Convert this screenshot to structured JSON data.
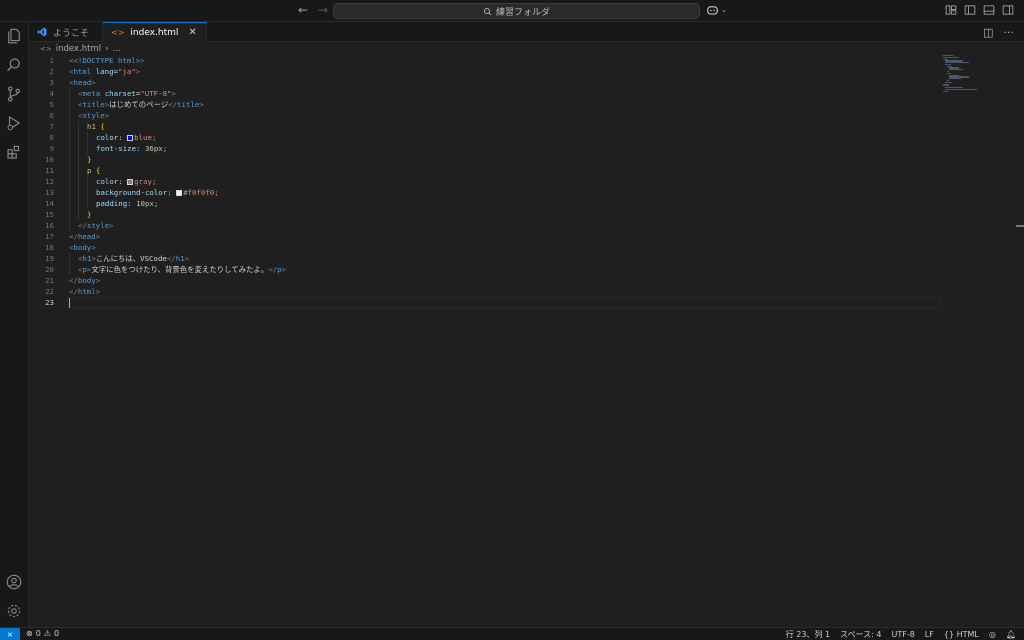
{
  "titlebar": {
    "search_text": "練習フォルダ"
  },
  "tabs": [
    {
      "label": "ようこそ"
    },
    {
      "label": "index.html"
    }
  ],
  "breadcrumb": {
    "file": "index.html",
    "more": "..."
  },
  "editor": {
    "lines": [
      "1",
      "2",
      "3",
      "4",
      "5",
      "6",
      "7",
      "8",
      "9",
      "10",
      "11",
      "12",
      "13",
      "14",
      "15",
      "16",
      "17",
      "18",
      "19",
      "20",
      "21",
      "22",
      "23"
    ],
    "code": {
      "l1": "<!DOCTYPE html>",
      "l2_tag": "html",
      "l2_attr": "lang",
      "l2_val": "\"ja\"",
      "l3": "head",
      "l4_tag": "meta",
      "l4_attr": "charset",
      "l4_val": "\"UTF-8\"",
      "l5_tag": "title",
      "l5_text": "はじめてのページ",
      "l6": "style",
      "l7_sel": "h1",
      "l8_prop": "color:",
      "l8_val": "blue;",
      "l9_prop": "font-size:",
      "l9_val": "36px;",
      "l11_sel": "p",
      "l12_prop": "color:",
      "l12_val": "gray;",
      "l13_prop": "background-color:",
      "l13_val": "#f0f0f0;",
      "l14_prop": "padding:",
      "l14_val": "10px;",
      "l16": "style",
      "l17": "head",
      "l18": "body",
      "l19_tag": "h1",
      "l19_text": "こんにちは、VSCode",
      "l20_tag": "p",
      "l20_text": "文字に色をつけたり、背景色を変えたりしてみたよ。",
      "l21": "body",
      "l22": "html"
    }
  },
  "statusbar": {
    "errors": "0",
    "warnings": "0",
    "position": "行 23、列 1",
    "spaces": "スペース: 4",
    "encoding": "UTF-8",
    "eol": "LF",
    "language": "HTML"
  },
  "colors": {
    "accent": "#0078d4",
    "swatch_blue": "#0000ff",
    "swatch_gray": "#808080",
    "swatch_bg": "#f0f0f0"
  }
}
